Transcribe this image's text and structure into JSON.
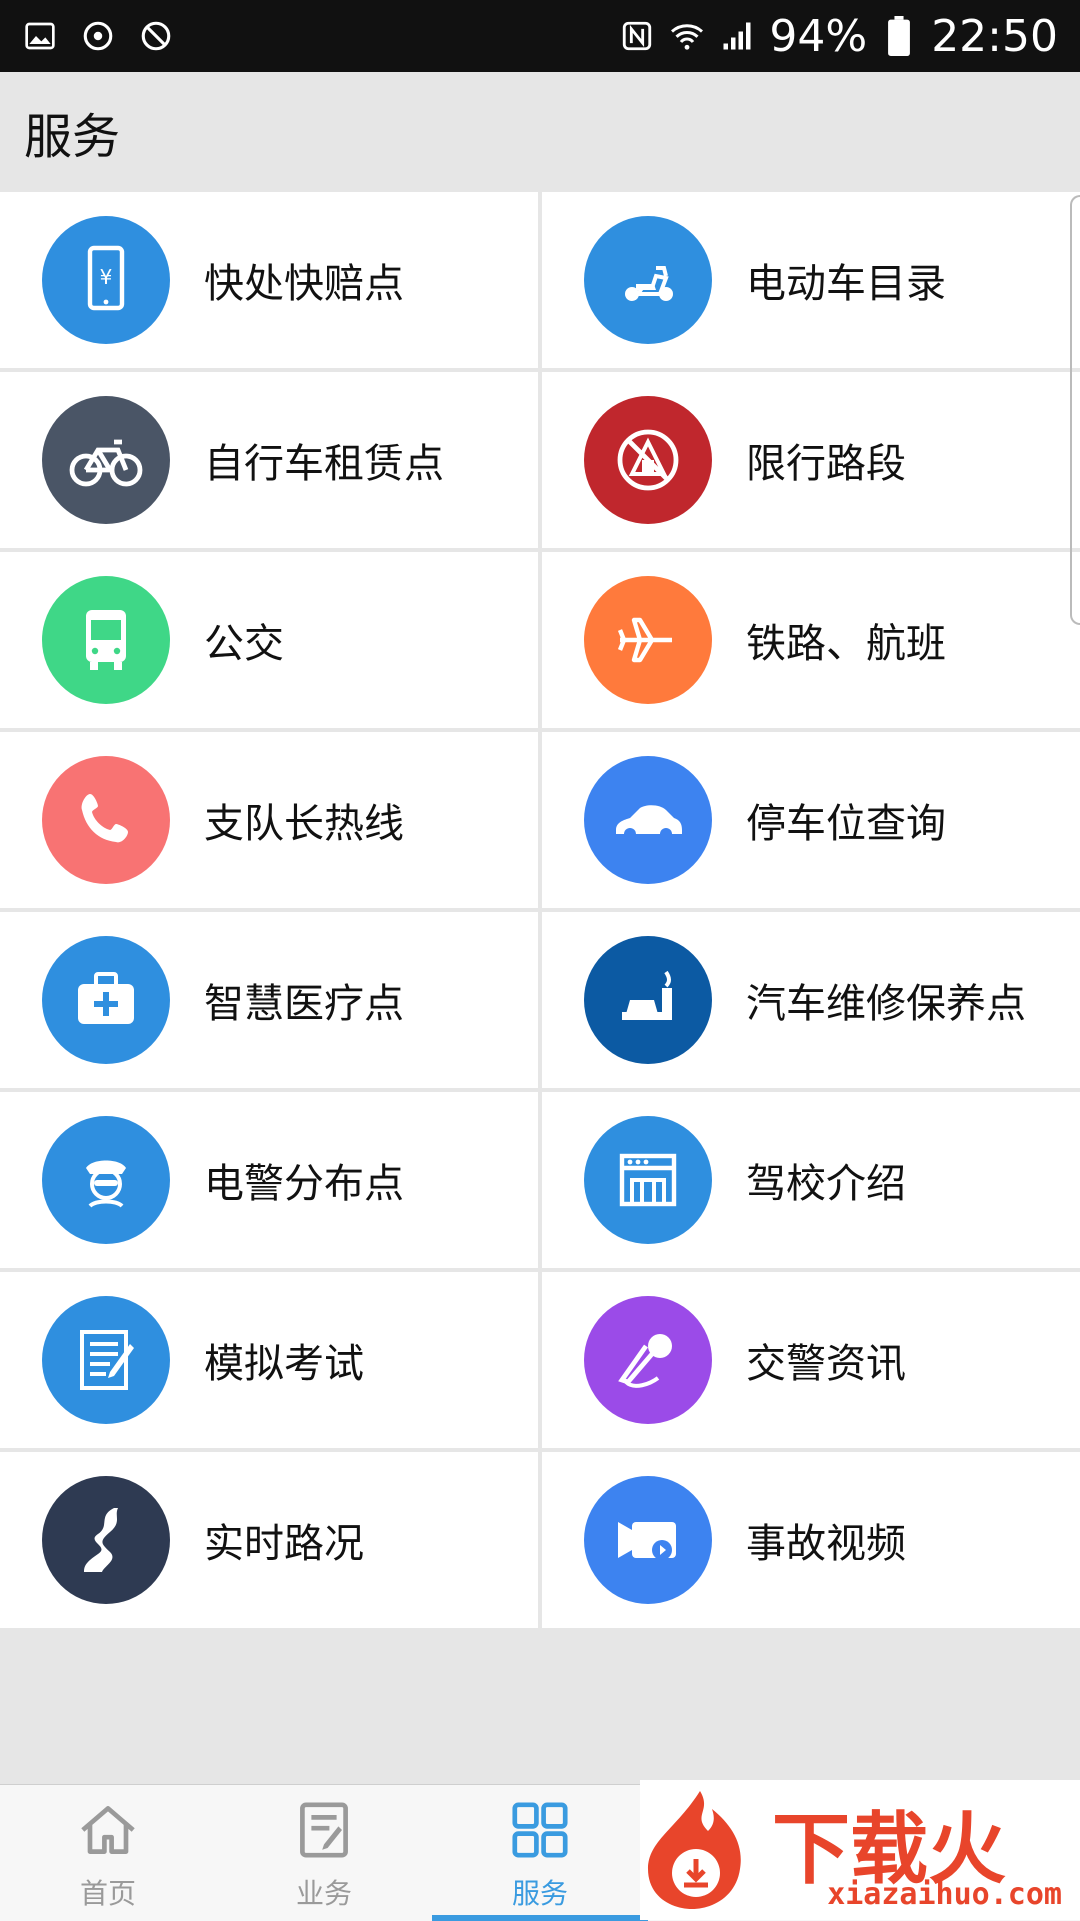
{
  "status_bar": {
    "battery": "94%",
    "time": "22:50",
    "icons": [
      "gallery-icon",
      "sync-icon",
      "blocked-icon",
      "nfc-icon",
      "wifi-icon",
      "signal-icon",
      "battery-icon"
    ]
  },
  "header": {
    "title": "服务"
  },
  "services": [
    {
      "label": "快处快赔点",
      "icon": "phone-payment-icon",
      "color": "#2f8fdf"
    },
    {
      "label": "电动车目录",
      "icon": "scooter-icon",
      "color": "#2f8fdf"
    },
    {
      "label": "自行车租赁点",
      "icon": "bicycle-icon",
      "color": "#4a5566"
    },
    {
      "label": "限行路段",
      "icon": "restricted-road-icon",
      "color": "#c0272d"
    },
    {
      "label": "公交",
      "icon": "bus-icon",
      "color": "#3fd787"
    },
    {
      "label": "铁路、航班",
      "icon": "airplane-icon",
      "color": "#ff7a3c"
    },
    {
      "label": "支队长热线",
      "icon": "phone-icon",
      "color": "#f87373"
    },
    {
      "label": "停车位查询",
      "icon": "car-icon",
      "color": "#3d83f0"
    },
    {
      "label": "智慧医疗点",
      "icon": "medical-kit-icon",
      "color": "#2f8fdf"
    },
    {
      "label": "汽车维修保养点",
      "icon": "car-repair-icon",
      "color": "#0c5aa3"
    },
    {
      "label": "电警分布点",
      "icon": "police-icon",
      "color": "#2f8fdf"
    },
    {
      "label": "驾校介绍",
      "icon": "school-building-icon",
      "color": "#2f8fdf"
    },
    {
      "label": "模拟考试",
      "icon": "exam-paper-icon",
      "color": "#2f8fdf"
    },
    {
      "label": "交警资讯",
      "icon": "microphone-icon",
      "color": "#9b4be8"
    },
    {
      "label": "实时路况",
      "icon": "winding-road-icon",
      "color": "#2e3a52"
    },
    {
      "label": "事故视频",
      "icon": "video-camera-icon",
      "color": "#3d83f0"
    }
  ],
  "tabs": [
    {
      "label": "首页",
      "icon": "home-icon",
      "active": false
    },
    {
      "label": "业务",
      "icon": "business-doc-icon",
      "active": false
    },
    {
      "label": "服务",
      "icon": "grid-icon",
      "active": true
    }
  ],
  "watermark": {
    "text": "下载火",
    "url_text": "xiazaihuo.com"
  }
}
